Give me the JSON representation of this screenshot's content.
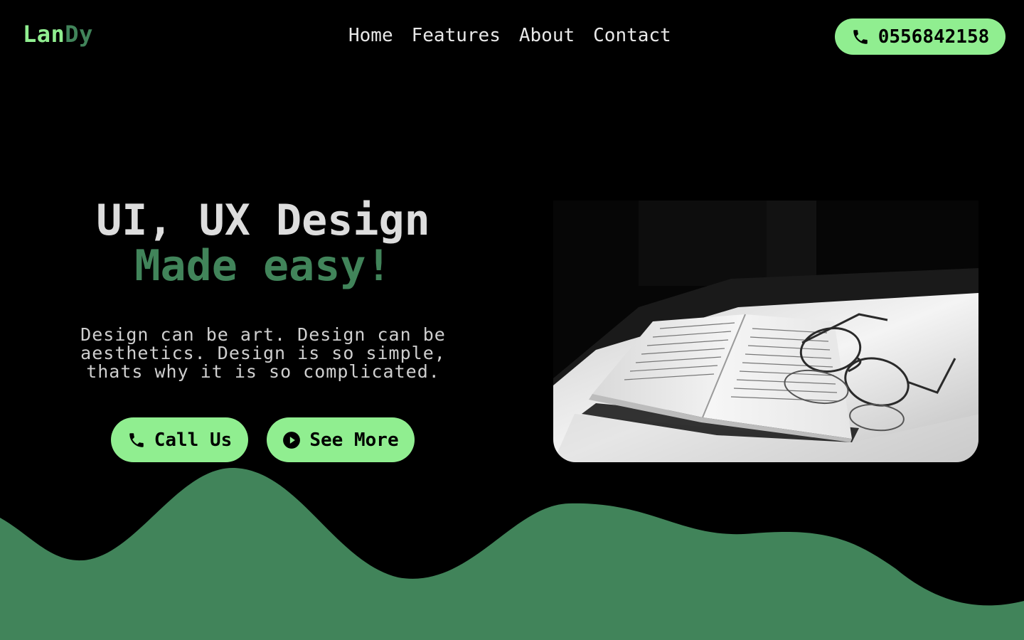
{
  "brand": {
    "part1": "Lan",
    "part2": "Dy"
  },
  "nav": {
    "items": [
      {
        "label": "Home"
      },
      {
        "label": "Features"
      },
      {
        "label": "About"
      },
      {
        "label": "Contact"
      }
    ]
  },
  "header": {
    "phone": "0556842158"
  },
  "hero": {
    "title_line1": "UI, UX Design",
    "title_line2": "Made easy!",
    "description": "Design can be art. Design can be aesthetics. Design is so simple, thats why it is so complicated.",
    "call_label": "Call Us",
    "more_label": "See More"
  },
  "colors": {
    "accent_light": "#90ee90",
    "accent_dark": "#41845a",
    "background": "#000000",
    "text": "#e8e8e8"
  },
  "icons": {
    "phone": "phone-icon",
    "play": "play-circle-icon"
  }
}
